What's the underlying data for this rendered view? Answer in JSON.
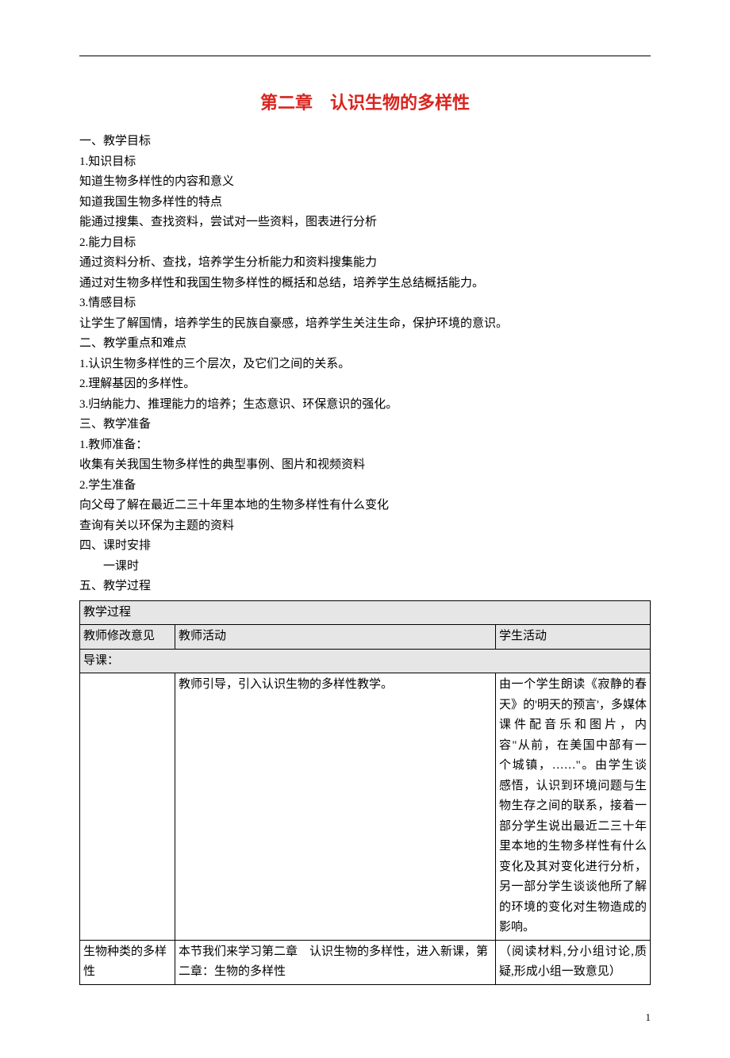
{
  "title": "第二章　认识生物的多样性",
  "sections": {
    "s1_h": "一、教学目标",
    "s1_1": "1.知识目标",
    "s1_1a": "知道生物多样性的内容和意义",
    "s1_1b": "知道我国生物多样性的特点",
    "s1_1c": "能通过搜集、查找资料，尝试对一些资料，图表进行分析",
    "s1_2": "2.能力目标",
    "s1_2a": "通过资料分析、查找，培养学生分析能力和资料搜集能力",
    "s1_2b": "通过对生物多样性和我国生物多样性的概括和总结，培养学生总结概括能力。",
    "s1_3": "3.情感目标",
    "s1_3a": "让学生了解国情，培养学生的民族自豪感，培养学生关注生命，保护环境的意识。",
    "s2_h": "二、教学重点和难点",
    "s2_1": "1.认识生物多样性的三个层次，及它们之间的关系。",
    "s2_2": "2.理解基因的多样性。",
    "s2_3": "3.归纳能力、推理能力的培养；生态意识、环保意识的强化。",
    "s3_h": "三、教学准备",
    "s3_1": "1.教师准备：",
    "s3_1a": "收集有关我国生物多样性的典型事例、图片和视频资料",
    "s3_2": "2.学生准备",
    "s3_2a": "向父母了解在最近二三十年里本地的生物多样性有什么变化",
    "s3_2b": "查询有关以环保为主题的资料",
    "s4_h": "四、课时安排",
    "s4_1": "一课时",
    "s5_h": "五、教学过程"
  },
  "table": {
    "r1c1": "教学过程",
    "r2c1": "教师修改意见",
    "r2c2": "教师活动",
    "r2c3": "学生活动",
    "r3c1": "导课：",
    "r4c1": "",
    "r4c2": "教师引导，引入认识生物的多样性教学。",
    "r4c3": "由一个学生朗读《寂静的春天》的'明天的预言'，多媒体课件配音乐和图片，内容\"从前，在美国中部有一个城镇，……\"。由学生谈感悟，认识到环境问题与生物生存之间的联系，接着一部分学生说出最近二三十年里本地的生物多样性有什么变化及其对变化进行分析，另一部分学生谈谈他所了解的环境的变化对生物造成的影响。",
    "r5c1": "生物种类的多样性",
    "r5c2": "本节我们来学习第二章　认识生物的多样性，进入新课，第二章：生物的多样性",
    "r5c3": "（阅读材料,分小组讨论,质疑,形成小组一致意见）"
  },
  "page_number": "1"
}
